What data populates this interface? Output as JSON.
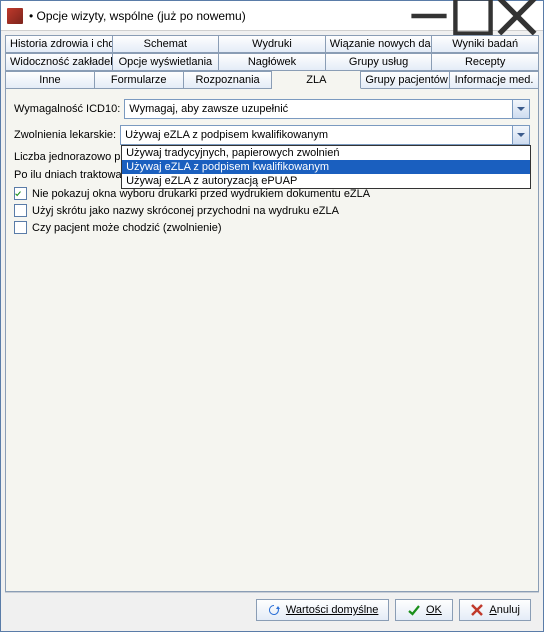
{
  "window": {
    "title": "• Opcje wizyty, wspólne (już po nowemu)"
  },
  "tabs": {
    "row1": [
      "Historia zdrowia i choroby",
      "Schemat",
      "Wydruki",
      "Wiązanie nowych danych",
      "Wyniki badań"
    ],
    "row2": [
      "Widoczność zakładek",
      "Opcje wyświetlania",
      "Nagłówek",
      "Grupy usług",
      "Recepty"
    ],
    "row3": [
      "Inne",
      "Formularze",
      "Rozpoznania",
      "ZLA",
      "Grupy pacjentów",
      "Informacje med."
    ],
    "active": "ZLA"
  },
  "form": {
    "icd10_label": "Wymagalność ICD10:",
    "icd10_value": "Wymagaj, aby zawsze uzupełnić",
    "zwolnienia_label": "Zwolnienia lekarskie:",
    "zwolnienia_value": "Używaj eZLA z podpisem kwalifikowanym",
    "zwolnienia_options": [
      "Używaj tradycyjnych, papierowych zwolnień",
      "Używaj eZLA z podpisem kwalifikowanym",
      "Używaj eZLA z autoryzacją ePUAP"
    ],
    "liczba_label": "Liczba jednorazowo p",
    "poilu_label": "Po ilu dniach traktowa",
    "check1": "Nie pokazuj okna wyboru drukarki przed wydrukiem dokumentu eZLA",
    "check2": "Użyj skrótu jako nazwy skróconej przychodni na wydruku eZLA",
    "check3": "Czy pacjent może chodzić (zwolnienie)"
  },
  "footer": {
    "defaults": "Wartości domyślne",
    "ok": "OK",
    "cancel": "Anuluj"
  }
}
